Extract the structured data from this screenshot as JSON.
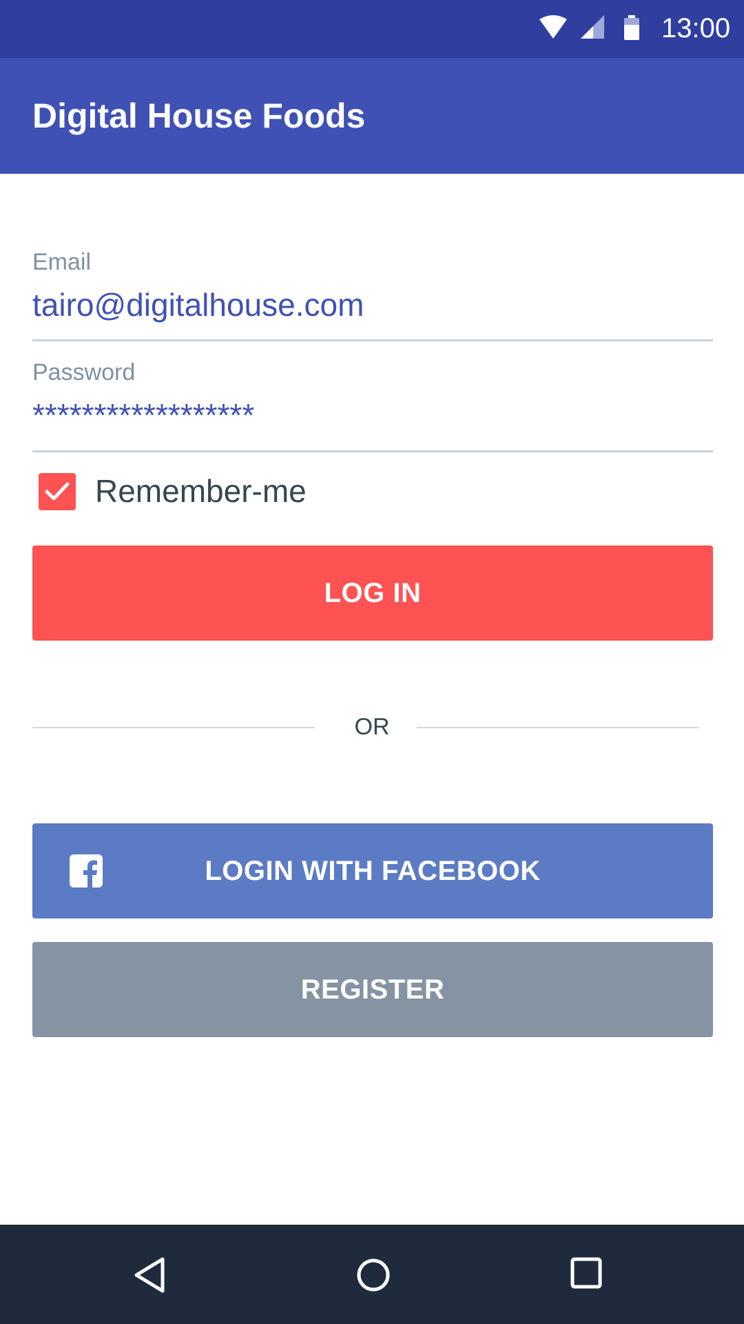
{
  "status_bar": {
    "time": "13:00",
    "icons": [
      "wifi-icon",
      "cell-signal-icon",
      "battery-icon"
    ]
  },
  "app_bar": {
    "title": "Digital House Foods"
  },
  "form": {
    "email": {
      "label": "Email",
      "value": "tairo@digitalhouse.com"
    },
    "password": {
      "label": "Password",
      "value": "******************"
    },
    "remember": {
      "label": "Remember-me",
      "checked": true
    },
    "login_button": "LOG IN",
    "divider_text": "OR",
    "facebook_button": "LOGIN WITH FACEBOOK",
    "register_button": "REGISTER"
  },
  "colors": {
    "status_bar": "#303F9F",
    "app_bar": "#3F51B5",
    "accent": "#FF5252",
    "facebook": "#5B7BC4",
    "register": "#8593A3",
    "nav_bar": "#1F2B3C"
  },
  "nav_bar": {
    "icons": [
      "back-icon",
      "home-icon",
      "recent-apps-icon"
    ]
  }
}
